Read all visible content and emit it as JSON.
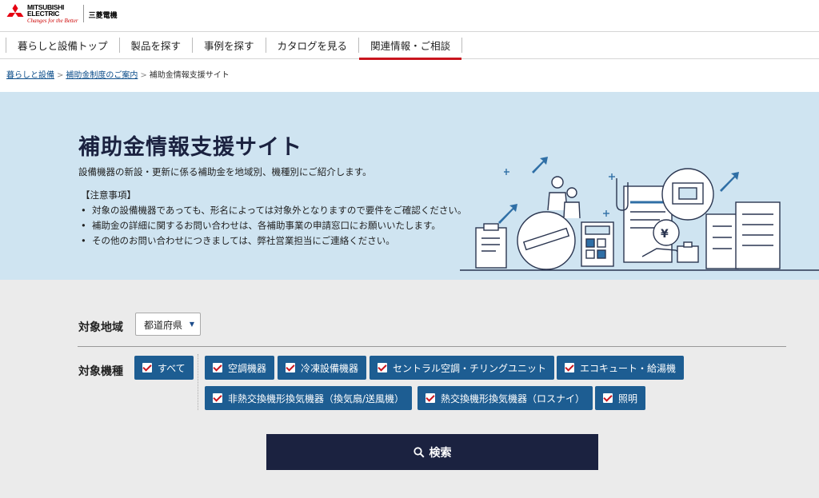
{
  "brand": {
    "name_en_line1": "MITSUBISHI",
    "name_en_line2": "ELECTRIC",
    "tagline": "Changes for the Better",
    "name_jp": "三菱電機",
    "color": "#e60012"
  },
  "nav": {
    "items": [
      {
        "label": "暮らしと設備トップ",
        "active": false
      },
      {
        "label": "製品を探す",
        "active": false
      },
      {
        "label": "事例を探す",
        "active": false
      },
      {
        "label": "カタログを見る",
        "active": false
      },
      {
        "label": "関連情報・ご相談",
        "active": true
      }
    ]
  },
  "breadcrumb": {
    "items": [
      "暮らしと設備",
      "補助金制度のご案内"
    ],
    "current": "補助金情報支援サイト",
    "separator": ">"
  },
  "hero": {
    "title": "補助金情報支援サイト",
    "subtitle": "設備機器の新設・更新に係る補助金を地域別、機種別にご紹介します。",
    "notice_heading": "【注意事項】",
    "notices": [
      "対象の設備機器であっても、形名によっては対象外となりますので要件をご確認ください。",
      "補助金の詳細に関するお問い合わせは、各補助事業の申請窓口にお願いいたします。",
      "その他のお問い合わせにつきましては、弊社営業担当にご連絡ください。"
    ],
    "illustration_currency": "¥"
  },
  "search": {
    "region_label": "対象地域",
    "region_select": "都道府県",
    "equipment_label": "対象機種",
    "all_label": "すべて",
    "categories": [
      "空調機器",
      "冷凍設備機器",
      "セントラル空調・チリングユニット",
      "エコキュート・給湯機",
      "非熱交換機形換気機器（換気扇/送風機）",
      "熱交換機形換気機器（ロスナイ）",
      "照明"
    ],
    "button_label": "検索"
  },
  "colors": {
    "accent_red": "#c9151e",
    "chip_blue": "#1d5d92",
    "navy": "#1b2240",
    "hero_bg": "#cfe4f1",
    "search_bg": "#ebebeb"
  }
}
